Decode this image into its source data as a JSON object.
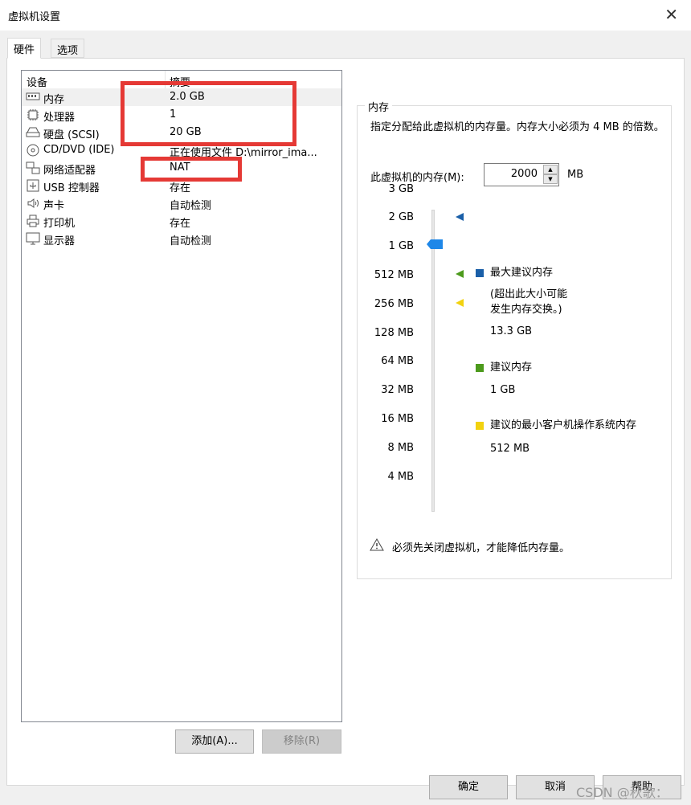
{
  "window": {
    "title": "虚拟机设置",
    "close_label": "✕"
  },
  "tabs": [
    {
      "label": "硬件"
    },
    {
      "label": "选项"
    }
  ],
  "device_list": {
    "headers": {
      "device": "设备",
      "summary": "摘要"
    },
    "rows": [
      {
        "name": "内存",
        "summary": "2.0 GB",
        "icon": "memory-icon"
      },
      {
        "name": "处理器",
        "summary": "1",
        "icon": "processor-icon"
      },
      {
        "name": "硬盘 (SCSI)",
        "summary": "20 GB",
        "icon": "hard-disk-icon"
      },
      {
        "name": "CD/DVD (IDE)",
        "summary": "正在使用文件 D:\\mirror_ima...",
        "icon": "cd-dvd-icon"
      },
      {
        "name": "网络适配器",
        "summary": "NAT",
        "icon": "network-adapter-icon"
      },
      {
        "name": "USB 控制器",
        "summary": "存在",
        "icon": "usb-icon"
      },
      {
        "name": "声卡",
        "summary": "自动检测",
        "icon": "speaker-icon"
      },
      {
        "name": "打印机",
        "summary": "存在",
        "icon": "printer-icon"
      },
      {
        "name": "显示器",
        "summary": "自动检测",
        "icon": "monitor-icon"
      }
    ]
  },
  "buttons": {
    "add": "添加(A)...",
    "remove": "移除(R)",
    "ok": "确定",
    "cancel": "取消",
    "help": "帮助"
  },
  "memory": {
    "group_title": "内存",
    "description": "指定分配给此虚拟机的内存量。内存大小必须为 4 MB 的倍数。",
    "field_label": "此虚拟机的内存(M):",
    "value": "2000",
    "unit": "MB",
    "slider_ticks": [
      "3 GB",
      "2 GB",
      "1 GB",
      "512 MB",
      "256 MB",
      "128 MB",
      "64 MB",
      "32 MB",
      "16 MB",
      "8 MB",
      "4 MB"
    ],
    "slider_value_mb": 2000,
    "legend": {
      "max_label": "最大建议内存",
      "max_note_1": "(超出此大小可能",
      "max_note_2": "发生内存交换。)",
      "max_value": "13.3 GB",
      "rec_label": "建议内存",
      "rec_value": "1 GB",
      "min_label": "建议的最小客户机操作系统内存",
      "min_value": "512 MB"
    },
    "warning": "必须先关闭虚拟机，才能降低内存量。",
    "colors": {
      "max": "#1a5fa8",
      "recommended": "#4c9a1c",
      "minimum": "#f2d20f",
      "thumb": "#1e87e8"
    }
  },
  "watermark": "CSDN @秋歌："
}
